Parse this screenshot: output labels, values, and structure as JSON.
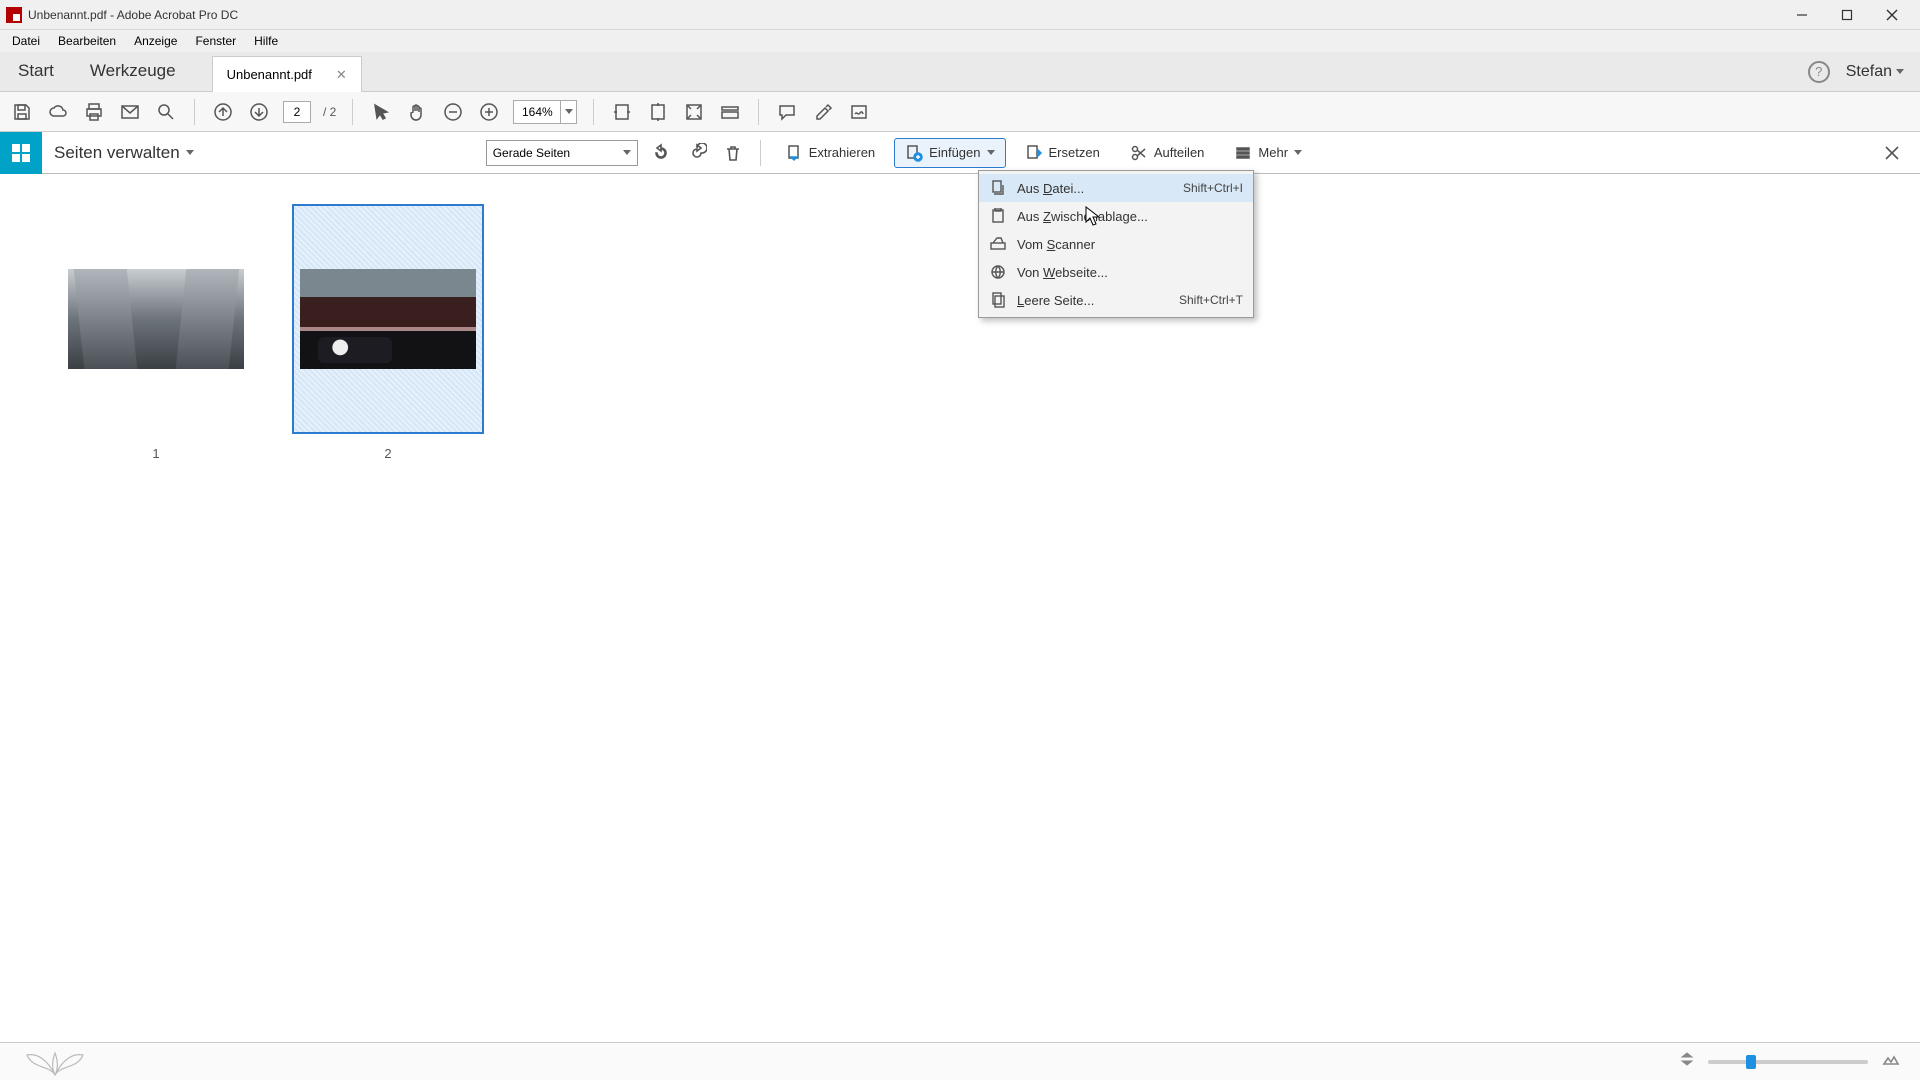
{
  "title": "Unbenannt.pdf - Adobe Acrobat Pro DC",
  "menu": {
    "datei": "Datei",
    "bearbeiten": "Bearbeiten",
    "anzeige": "Anzeige",
    "fenster": "Fenster",
    "hilfe": "Hilfe"
  },
  "tabs": {
    "start": "Start",
    "werkzeuge": "Werkzeuge",
    "doc": "Unbenannt.pdf"
  },
  "user": "Stefan",
  "pagebox": {
    "current": "2",
    "total": "/ 2"
  },
  "zoom": "164%",
  "tools_header": "Seiten verwalten",
  "filter_select": "Gerade Seiten",
  "actions": {
    "extrahieren": "Extrahieren",
    "einfuegen": "Einfügen",
    "ersetzen": "Ersetzen",
    "aufteilen": "Aufteilen",
    "mehr": "Mehr"
  },
  "dropdown": {
    "aus_datei": "Aus Datei...",
    "aus_datei_shortcut": "Shift+Ctrl+I",
    "aus_zwischenablage": "Aus Zwischenablage...",
    "vom_scanner": "Vom Scanner",
    "von_webseite": "Von Webseite...",
    "leere_seite": "Leere Seite...",
    "leere_seite_shortcut": "Shift+Ctrl+T"
  },
  "thumbs": {
    "p1": "1",
    "p2": "2"
  }
}
